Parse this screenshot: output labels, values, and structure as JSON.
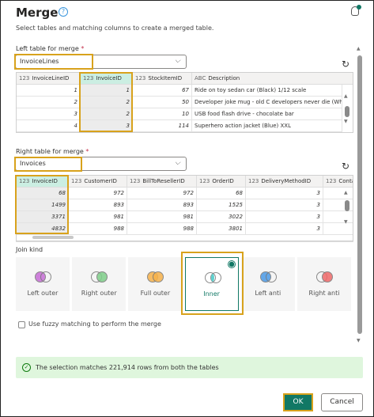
{
  "dialog": {
    "title": "Merge",
    "subtitle": "Select tables and matching columns to create a merged table."
  },
  "left": {
    "label": "Left table for merge",
    "required": "*",
    "value": "InvoiceLines",
    "columns": [
      {
        "type": "123",
        "name": "InvoiceLineID"
      },
      {
        "type": "123",
        "name": "InvoiceID"
      },
      {
        "type": "123",
        "name": "StockItemID"
      },
      {
        "type": "ABC",
        "name": "Description"
      }
    ],
    "rows": [
      [
        "1",
        "1",
        "67",
        "Ride on toy sedan car (Black) 1/12 scale"
      ],
      [
        "2",
        "2",
        "50",
        "Developer joke mug - old C developers never die (Wh"
      ],
      [
        "3",
        "2",
        "10",
        "USB food flash drive - chocolate bar"
      ],
      [
        "4",
        "3",
        "114",
        "Superhero action jacket (Blue) XXL"
      ]
    ]
  },
  "right": {
    "label": "Right table for merge",
    "required": "*",
    "value": "Invoices",
    "columns": [
      {
        "type": "123",
        "name": "InvoiceID"
      },
      {
        "type": "123",
        "name": "CustomerID"
      },
      {
        "type": "123",
        "name": "BillToResellerID"
      },
      {
        "type": "123",
        "name": "OrderID"
      },
      {
        "type": "123",
        "name": "DeliveryMethodID"
      },
      {
        "type": "123",
        "name": "Conta"
      }
    ],
    "rows": [
      [
        "68",
        "972",
        "972",
        "68",
        "3",
        ""
      ],
      [
        "1499",
        "893",
        "893",
        "1525",
        "3",
        ""
      ],
      [
        "3371",
        "981",
        "981",
        "3022",
        "3",
        ""
      ],
      [
        "4832",
        "988",
        "988",
        "3801",
        "3",
        ""
      ]
    ]
  },
  "join": {
    "label": "Join kind",
    "options": [
      "Left outer",
      "Right outer",
      "Full outer",
      "Inner",
      "Left anti",
      "Right anti"
    ],
    "selected": "Inner"
  },
  "fuzzy_label": "Use fuzzy matching to perform the merge",
  "status": "The selection matches 221,914 rows from both the tables",
  "buttons": {
    "ok": "OK",
    "cancel": "Cancel"
  },
  "colors": {
    "accent": "#117865",
    "highlight": "#d8a21c",
    "success_bg": "#dff6dd"
  }
}
